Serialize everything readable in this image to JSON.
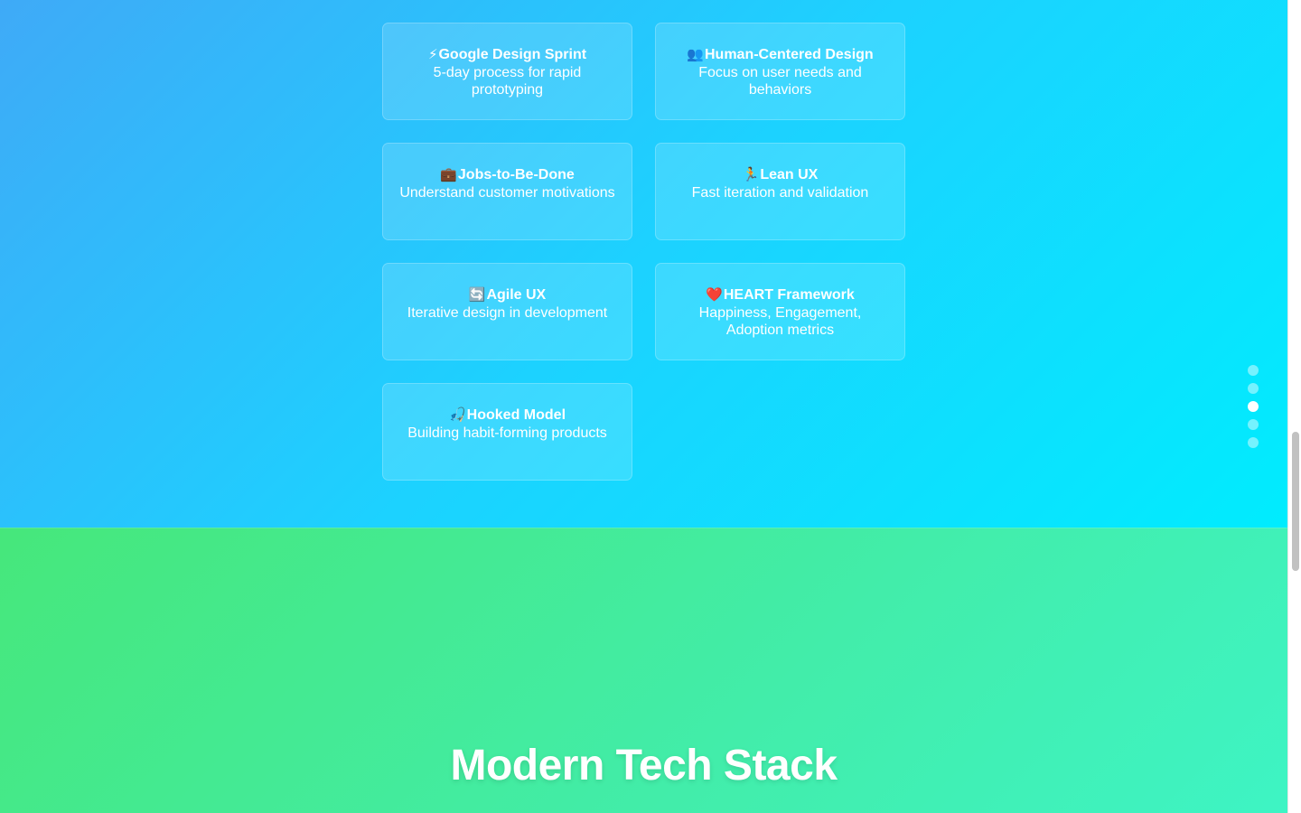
{
  "frameworks": [
    {
      "icon": "⚡",
      "icon_name": "lightning-icon",
      "title": "Google Design Sprint",
      "description": "5-day process for rapid prototyping"
    },
    {
      "icon": "👥",
      "icon_name": "people-icon",
      "title": "Human-Centered Design",
      "description": "Focus on user needs and behaviors"
    },
    {
      "icon": "💼",
      "icon_name": "briefcase-icon",
      "title": "Jobs-to-Be-Done",
      "description": "Understand customer motivations"
    },
    {
      "icon": "🏃",
      "icon_name": "runner-icon",
      "title": "Lean UX",
      "description": "Fast iteration and validation"
    },
    {
      "icon": "🔄",
      "icon_name": "refresh-icon",
      "title": "Agile UX",
      "description": "Iterative design in development"
    },
    {
      "icon": "❤️",
      "icon_name": "heart-icon",
      "title": "HEART Framework",
      "description": "Happiness, Engagement, Adoption metrics"
    },
    {
      "icon": "🎣",
      "icon_name": "fishing-hook-icon",
      "title": "Hooked Model",
      "description": "Building habit-forming products"
    }
  ],
  "nav_dots": {
    "count": 5,
    "active_index": 2
  },
  "next_section": {
    "heading": "Modern Tech Stack"
  },
  "colors": {
    "blue_section_start": "#3faaf7",
    "blue_section_end": "#00ecfe",
    "green_section_start": "#46e77b",
    "green_section_end": "#3ef4c4",
    "text": "#ffffff"
  }
}
